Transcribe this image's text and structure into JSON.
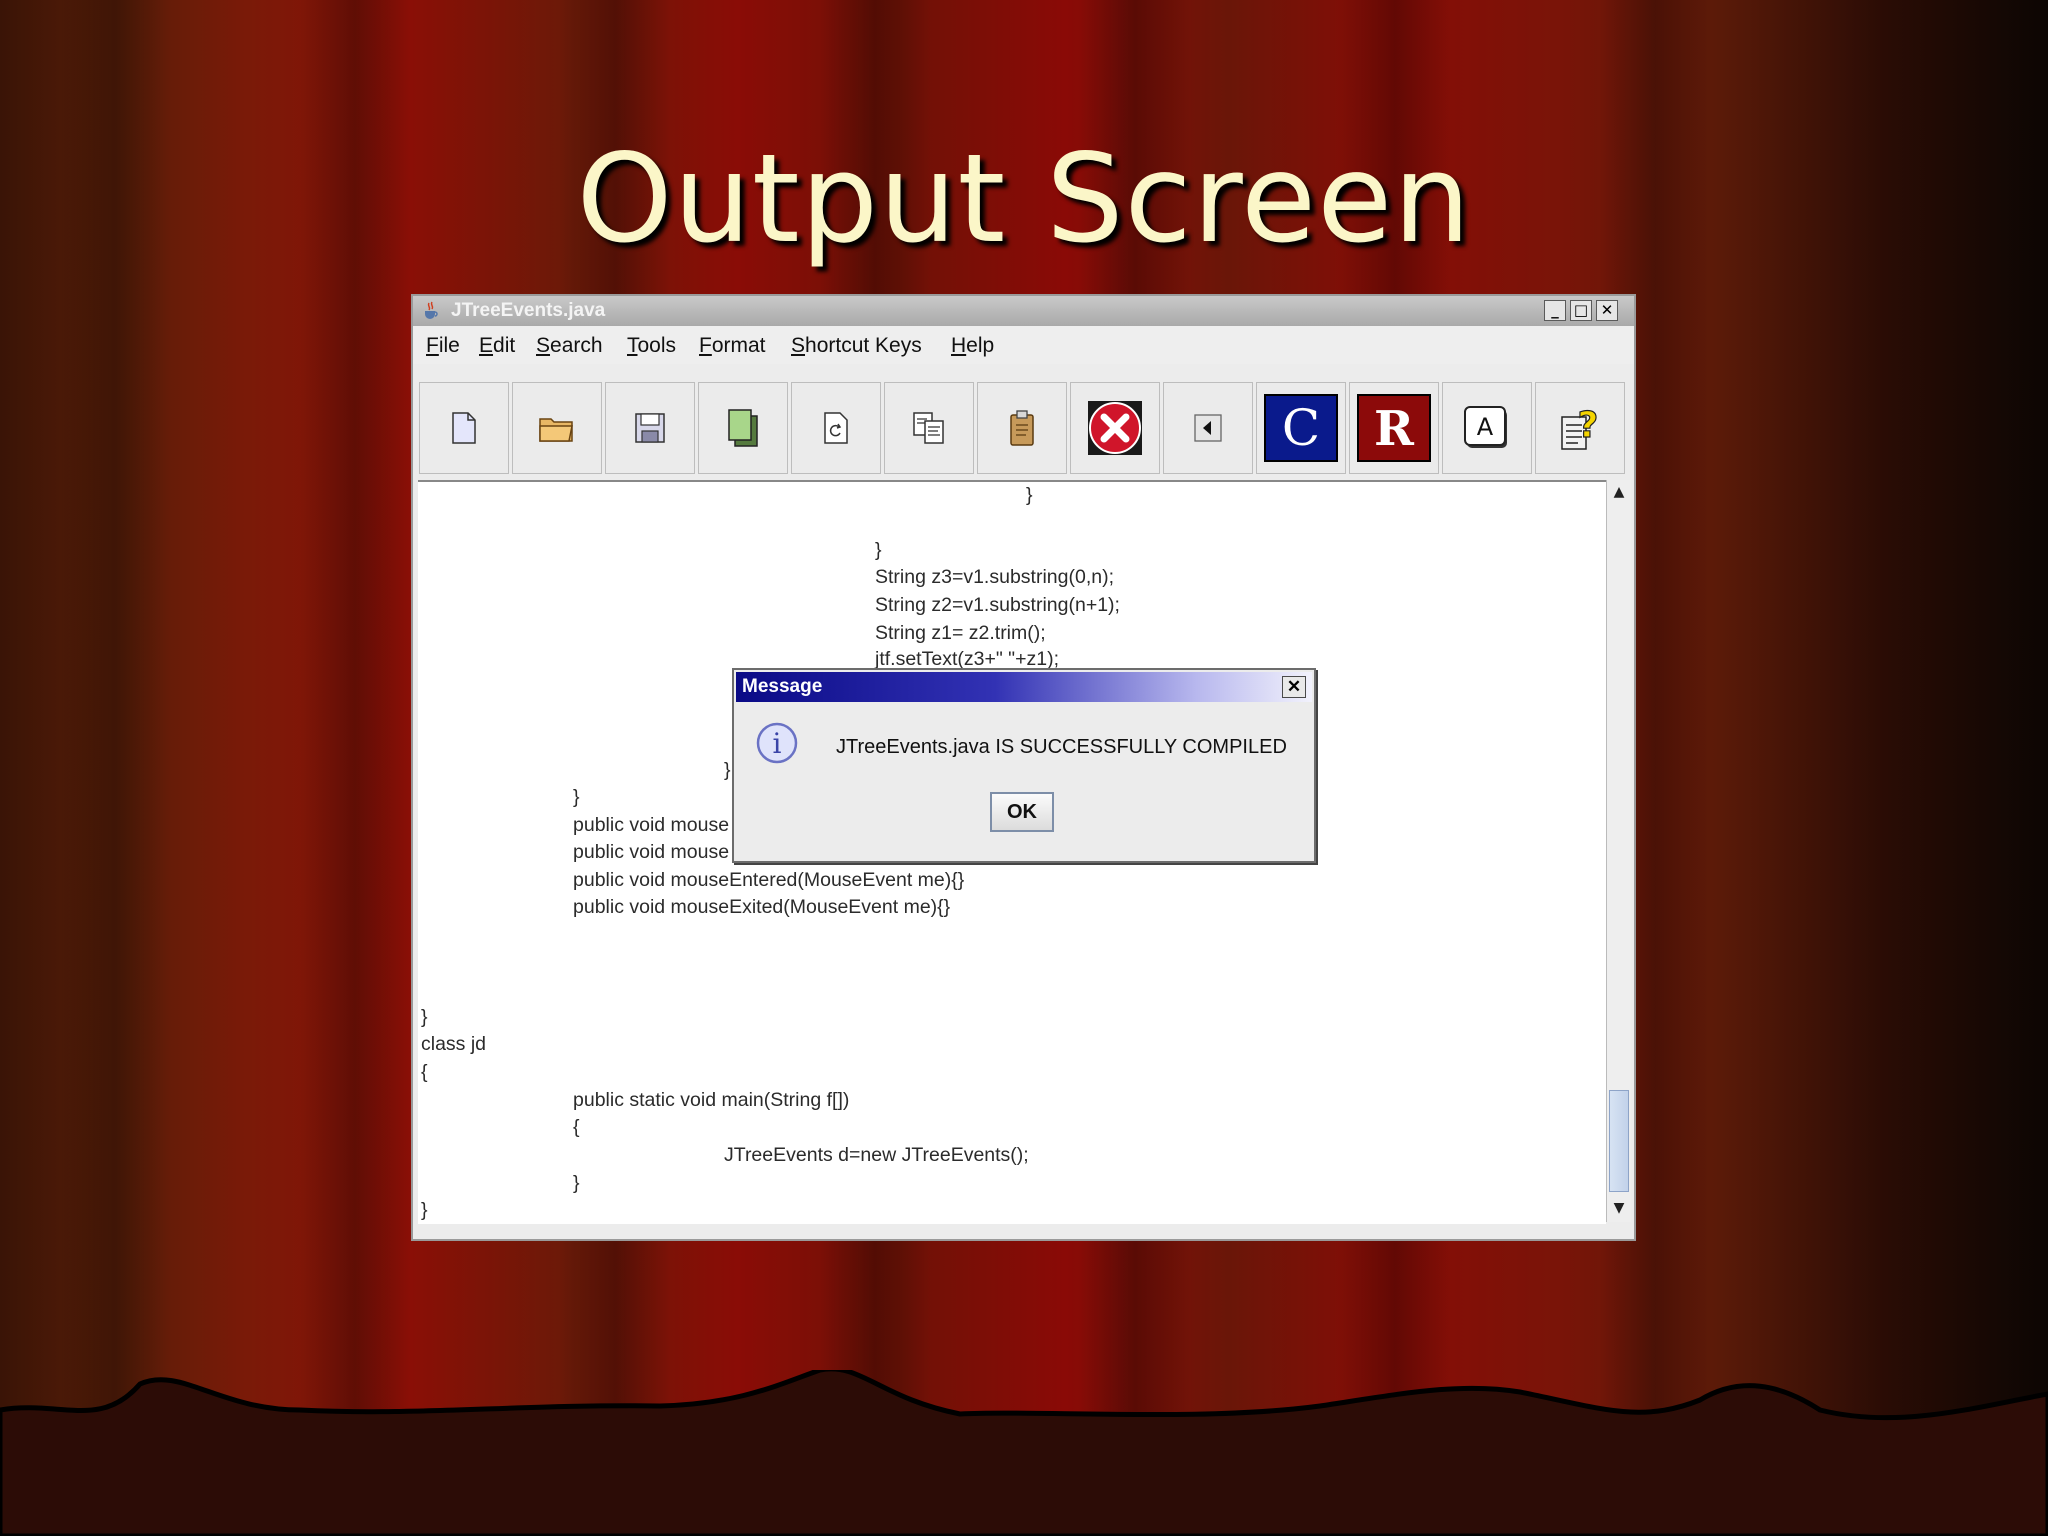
{
  "slide": {
    "title": "Output Screen"
  },
  "window": {
    "title": "JTreeEvents.java",
    "controls": {
      "minimize": "_",
      "maximize": "□",
      "close": "✕"
    }
  },
  "menubar": {
    "items": [
      {
        "mnemonic": "F",
        "rest": "ile"
      },
      {
        "mnemonic": "E",
        "rest": "dit"
      },
      {
        "mnemonic": "S",
        "rest": "earch"
      },
      {
        "mnemonic": "T",
        "rest": "ools"
      },
      {
        "mnemonic": "F",
        "rest": "ormat"
      },
      {
        "mnemonic": "S",
        "rest": "hortcut Keys"
      },
      {
        "mnemonic": "H",
        "rest": "elp"
      }
    ]
  },
  "toolbar": {
    "icons": [
      "new-file-icon",
      "open-folder-icon",
      "save-icon",
      "copy-pages-icon",
      "refresh-document-icon",
      "find-replace-icon",
      "clipboard-icon",
      "stop-icon",
      "back-arrow-icon",
      "compile-icon",
      "run-icon",
      "font-icon",
      "help-icon"
    ],
    "compile_letter": "C",
    "run_letter": "R",
    "font_letter": "A",
    "help_glyph": "?",
    "colors": {
      "compile_bg": "#0a1a8c",
      "run_bg": "#8c0a0a",
      "stop_bg": "#d0152a"
    }
  },
  "editor": {
    "lines": [
      "}",
      "}",
      "String z3=v1.substring(0,n);",
      "String z2=v1.substring(n+1);",
      "String z1= z2.trim();",
      "jtf.setText(z3+\" \"+z1);",
      "}",
      "}",
      "public void mouse",
      "public void mouse",
      "public void mouseEntered(MouseEvent me){}",
      "public void mouseExited(MouseEvent me){}",
      "}",
      "class jd",
      "{",
      "public static void main(String f[])",
      "{",
      "JTreeEvents d=new JTreeEvents();",
      "}",
      "}"
    ]
  },
  "scrollbar": {
    "up": "▲",
    "down": "▼"
  },
  "dialog": {
    "title": "Message",
    "close": "✕",
    "info_glyph": "i",
    "message": "JTreeEvents.java IS SUCCESSFULLY COMPILED",
    "ok_label": "OK"
  }
}
